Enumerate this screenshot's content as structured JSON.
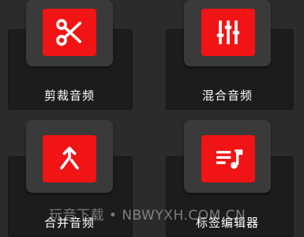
{
  "tiles": [
    {
      "label": "剪裁音频",
      "icon": "scissors-icon"
    },
    {
      "label": "混合音频",
      "icon": "equalizer-icon"
    },
    {
      "label": "合并音频",
      "icon": "merge-icon"
    },
    {
      "label": "标签编辑器",
      "icon": "music-playlist-icon"
    }
  ],
  "watermark": "玩音下载 • NBWYXH.COM.CN",
  "colors": {
    "background": "#2b2b2b",
    "accent": "#f01414",
    "plate": "#1b1d1b",
    "cap": "#3a3a3a"
  }
}
